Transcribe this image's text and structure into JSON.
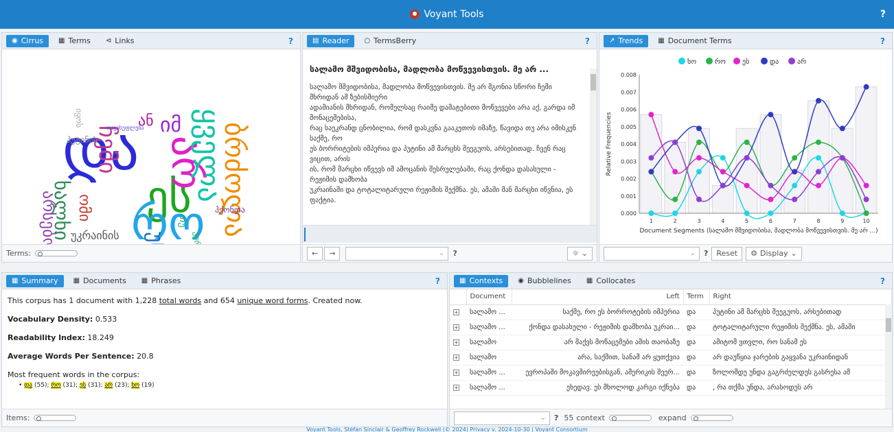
{
  "app": {
    "title": "Voyant Tools",
    "help": "?"
  },
  "cirrus_panel": {
    "tabs": [
      {
        "label": "Cirrus",
        "icon": "eye-icon"
      },
      {
        "label": "Terms",
        "icon": "table-icon"
      },
      {
        "label": "Links",
        "icon": "share-icon"
      }
    ],
    "help": "?",
    "footer_label": "Terms:",
    "words": [
      {
        "text": "და",
        "color": "#2b2bd8"
      },
      {
        "text": "ეს",
        "color": "#1ea61e"
      },
      {
        "text": "რო",
        "color": "#23a5e8"
      },
      {
        "text": "არ",
        "color": "#e020c8"
      },
      {
        "text": "ყველა",
        "color": "#12c4a8"
      },
      {
        "text": "იმ",
        "color": "#9b27d6"
      },
      {
        "text": "ან",
        "color": "#b01ca0"
      },
      {
        "text": "უკრაინის",
        "color": "#555555"
      },
      {
        "text": "ბრძოლა",
        "color": "#f08c00"
      },
      {
        "text": "ჩემი",
        "color": "#c0388e"
      },
      {
        "text": "ხალხი",
        "color": "#2e8b57"
      },
      {
        "text": "უნდა",
        "color": "#1e6fbf"
      },
      {
        "text": "არსებობა",
        "color": "#8e44ad"
      },
      {
        "text": "ომი",
        "color": "#c0392b"
      },
      {
        "text": "თუ",
        "color": "#16a085"
      },
      {
        "text": "პუტინის",
        "color": "#888888"
      },
      {
        "text": "თავისუფლება",
        "color": "#5b4bd1"
      },
      {
        "text": "ვერ",
        "color": "#27ae60"
      },
      {
        "text": "იყოს",
        "color": "#aaaaaa"
      },
      {
        "text": "ჰქონდა",
        "color": "#6c3483"
      }
    ]
  },
  "reader_panel": {
    "tabs": [
      {
        "label": "Reader",
        "icon": "document-icon"
      },
      {
        "label": "TermsBerry",
        "icon": "radio-icon"
      }
    ],
    "help": "?",
    "title": "სალამო მშვიდობისა, მადლობა მოწვევისთვის. მე არ ...",
    "paragraphs": [
      "სალამო მშვიდობისა, მადლობა მოწვევისთვის. მე არ მგონია სწორი ჩემი მხრიდან ამ ზებისმიერი",
      "ადამიანის მხრიდან, რომელსაც რაიმე დამატებითი მოწვევები არა აქ, გარდა იმ მონაცემებისა,",
      "რაც საეკრანდ ცნობილია, რომ დასკვნა გააკეთოს იმაზე, წავიდა თუ არა იმისკენ საქმე, რო",
      "ეს ბორრიტების იმპერია და პუტინი ამ მარცხს შეეგუოს, არსებითად. ჩვენ რაც ვიცით, არის",
      "ის, რომ მარცხი იწვევს იმ ამოცანის შესრულებაში, რაც ქონდა დასახული - რეჟიმის დამხობა",
      "უკრაინაში და ტოტალიტარული რეჟიმის შექმნა. ეს, ამაში მან მარცხი იწვნია, ეს ფაქტია."
    ],
    "footer_help": "?"
  },
  "trends_panel": {
    "tabs": [
      {
        "label": "Trends",
        "icon": "line-chart-icon"
      },
      {
        "label": "Document Terms",
        "icon": "table-icon"
      }
    ],
    "help": "?",
    "footer": {
      "help": "?",
      "reset": "Reset",
      "display": "Display"
    }
  },
  "chart_data": {
    "type": "line",
    "xlabel": "Document Segments (სალამო მშვიდობისა, მადლობა მოწვევისთვის. მე არ ...)",
    "ylabel": "Relative Frequencies",
    "ylim": [
      0,
      0.008
    ],
    "yticks": [
      "0.000",
      "0.001",
      "0.002",
      "0.003",
      "0.004",
      "0.005",
      "0.006",
      "0.007",
      "0.008"
    ],
    "x": [
      1,
      2,
      3,
      4,
      5,
      6,
      7,
      8,
      9,
      10
    ],
    "bars": [
      0.0057,
      0.0041,
      0.0049,
      0.0016,
      0.0049,
      0.0057,
      0.0025,
      0.0065,
      0.0049,
      0.0073
    ],
    "legend": "top",
    "series": [
      {
        "name": "ხო",
        "color": "#1ed6e6",
        "values": [
          0.0,
          0.0,
          0.0024,
          0.0032,
          0.0,
          0.0,
          0.0016,
          0.0032,
          0.0,
          0.0
        ]
      },
      {
        "name": "რო",
        "color": "#2fb24a",
        "values": [
          0.0024,
          0.0008,
          0.0041,
          0.0024,
          0.0041,
          0.0016,
          0.0032,
          0.0041,
          0.0032,
          0.0
        ]
      },
      {
        "name": "ეს",
        "color": "#e025d0",
        "values": [
          0.0057,
          0.0024,
          0.0032,
          0.0024,
          0.0016,
          0.0008,
          0.0024,
          0.0016,
          0.0032,
          0.0016
        ]
      },
      {
        "name": "და",
        "color": "#2c3cc4",
        "values": [
          0.0024,
          0.0041,
          0.0049,
          0.0016,
          0.0032,
          0.0057,
          0.0024,
          0.0065,
          0.0049,
          0.0073
        ]
      },
      {
        "name": "არ",
        "color": "#8e3ed1",
        "values": [
          0.0032,
          0.0041,
          0.0008,
          0.0016,
          0.0032,
          0.0016,
          0.0008,
          0.0024,
          0.0032,
          0.0008
        ]
      }
    ]
  },
  "summary_panel": {
    "tabs": [
      {
        "label": "Summary",
        "icon": "table-icon"
      },
      {
        "label": "Documents",
        "icon": "table-icon"
      },
      {
        "label": "Phrases",
        "icon": "table-icon"
      }
    ],
    "help": "?",
    "line1_a": "This corpus has 1 document with 1,228 ",
    "line1_b": "total words",
    "line1_c": " and 654 ",
    "line1_d": "unique word forms",
    "line1_e": ". Created now.",
    "vocab_label": "Vocabulary Density:",
    "vocab_value": "0.533",
    "read_label": "Readability Index:",
    "read_value": "18.249",
    "avg_label": "Average Words Per Sentence:",
    "avg_value": "20.8",
    "freq_label": "Most frequent words in the corpus:",
    "freq": [
      {
        "word": "და",
        "count": "(55)"
      },
      {
        "word": "რო",
        "count": "(31)"
      },
      {
        "word": "ეს",
        "count": "(31)"
      },
      {
        "word": "არ",
        "count": "(23)"
      },
      {
        "word": "ხო",
        "count": "(19)"
      }
    ],
    "footer_label": "Items:"
  },
  "contexts_panel": {
    "tabs": [
      {
        "label": "Contexts",
        "icon": "table-icon"
      },
      {
        "label": "Bubblelines",
        "icon": "eye-icon"
      },
      {
        "label": "Collocates",
        "icon": "table-icon"
      }
    ],
    "help": "?",
    "columns": [
      "Document",
      "Left",
      "Term",
      "Right"
    ],
    "rows": [
      {
        "doc": "სალამო ...",
        "left": "საქმე, რო ეს ბორროტების იმპერია",
        "term": "და",
        "right": "პუტინი ამ მარცხს შეეგუოს, არსებითად"
      },
      {
        "doc": "სალამო ...",
        "left": "ქონდა დასახული - რეჟიმის დამხობა უკრაი...",
        "term": "და",
        "right": "ტოტალიტარული რეჟიმის შექმნა. ეს, ამაში"
      },
      {
        "doc": "სალამო",
        "left": "არ მაქვს მოწაცემები ამის თაობაზე",
        "term": "და",
        "right": "ამიტომ ვთვლი, რო სანამ ეს"
      },
      {
        "doc": "სალამო",
        "left": "არა, საქმით, სანამ არ ყუთქვია",
        "term": "და",
        "right": "არ დაუწყია ჯარების გაყვანა უკრაინიდან"
      },
      {
        "doc": "სალამო ...",
        "left": "ევროპაში მოკავშირეებისგან, ამერიკის შეერ...",
        "term": "და",
        "right": "ზოლომდე უნდა გაგრძელდეს გასრესა ამ"
      },
      {
        "doc": "სალამო ...",
        "left": "ეხედავ. ეს მხოლოდ კარგი იქნება",
        "term": "და",
        "right": ", რა თქმა უნდა, არასოდეს არ"
      }
    ],
    "footer": {
      "help": "?",
      "context_value": "55",
      "context_label": "context",
      "expand_label": "expand"
    }
  },
  "bottom_credit": "Voyant Tools, Stéfan Sinclair & Geoffrey Rockwell (© 2024) Privacy v. 2024-10-30 | Voyant Consortium"
}
